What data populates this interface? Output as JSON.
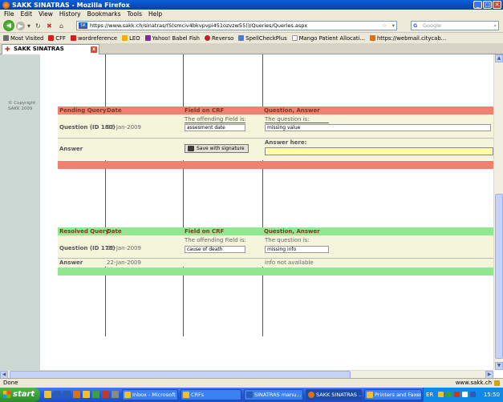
{
  "window": {
    "title": "SAKK SINATRAS - Mozilla Firefox"
  },
  "menu": [
    "File",
    "Edit",
    "View",
    "History",
    "Bookmarks",
    "Tools",
    "Help"
  ],
  "nav": {
    "url": "https://www.sakk.ch/sinatras/(S(smciv4bkvpvpi451ozvzw55))/Queries/Queries.aspx",
    "search_placeholder": "Google"
  },
  "bookmarks": [
    {
      "label": "Most Visited",
      "color": "#6b6b6b"
    },
    {
      "label": "CFF",
      "color": "#d0221b"
    },
    {
      "label": "wordreference",
      "color": "#d0221b"
    },
    {
      "label": "LEO",
      "color": "#f0b000"
    },
    {
      "label": "Yahoo! Babel Fish",
      "color": "#7b2ca0"
    },
    {
      "label": "Reverso",
      "color": "#c0202a"
    },
    {
      "label": "SpellCheckPlus",
      "color": "#4a7fd0"
    },
    {
      "label": "Mango Patient Allocati...",
      "color": "#ffffff"
    },
    {
      "label": "https://webmail.citycab...",
      "color": "#e07010"
    }
  ],
  "tab": {
    "title": "SAKK SINATRAS",
    "close": "x"
  },
  "sidebar": {
    "copyright": "© Copyright SAKK 2009"
  },
  "pending": {
    "color": "#f08070",
    "row_color": "#f5f5dc",
    "header": [
      "Pending Query",
      "Date",
      "Field on CRF",
      "Question, Answer"
    ],
    "question_label": "Question (ID 180)",
    "date": "22-Jan-2009",
    "field_caption": "The offending Field is:",
    "field_value": "assesment date",
    "question_caption": "The question is:",
    "question_value": "missing value",
    "answer_label": "Answer",
    "save_button": "Save with signature",
    "answer_caption": "Answer here:"
  },
  "resolved": {
    "color": "#90e890",
    "header": [
      "Resolved Query",
      "Date",
      "Field on CRF",
      "Question, Answer"
    ],
    "question_label": "Question (ID 178)",
    "date": "22-Jan-2009",
    "field_caption": "The offending Field is:",
    "field_value": "cause of death",
    "question_caption": "The question is:",
    "question_value": "missing info",
    "answer_label": "Answer",
    "answer_date": "22-Jan-2009",
    "answer_value": "info not available"
  },
  "status": {
    "text": "Done",
    "host": "www.sakk.ch"
  },
  "taskbar": {
    "start": "start",
    "tasks": [
      {
        "label": "Inbox - Microsoft ...",
        "color": "#f0c030"
      },
      {
        "label": "CRFs",
        "color": "#f0c030"
      },
      {
        "label": "SINATRAS manu...",
        "color": "#2b5db5"
      },
      {
        "label": "SAKK SINATRAS ...",
        "color": "#e07010"
      },
      {
        "label": "Printers and Faxes",
        "color": "#f0c030"
      }
    ],
    "lang": "ER",
    "clock": "15:50"
  }
}
